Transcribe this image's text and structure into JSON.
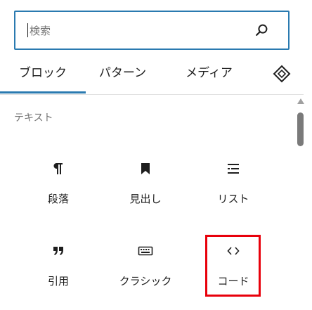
{
  "search": {
    "placeholder": "検索",
    "value": ""
  },
  "tabs": [
    {
      "label": "ブロック",
      "active": true
    },
    {
      "label": "パターン",
      "active": false
    },
    {
      "label": "メディア",
      "active": false
    }
  ],
  "tab_more_icon": "block-default-icon",
  "accent_color": "#2a7ab0",
  "highlight_color": "#e8000b",
  "category": {
    "title": "テキスト"
  },
  "blocks": [
    {
      "label": "段落",
      "icon": "paragraph-icon"
    },
    {
      "label": "見出し",
      "icon": "heading-bookmark-icon"
    },
    {
      "label": "リスト",
      "icon": "list-icon"
    },
    {
      "label": "引用",
      "icon": "quote-icon"
    },
    {
      "label": "クラシック",
      "icon": "keyboard-icon"
    },
    {
      "label": "コード",
      "icon": "code-icon",
      "highlighted": true
    }
  ]
}
